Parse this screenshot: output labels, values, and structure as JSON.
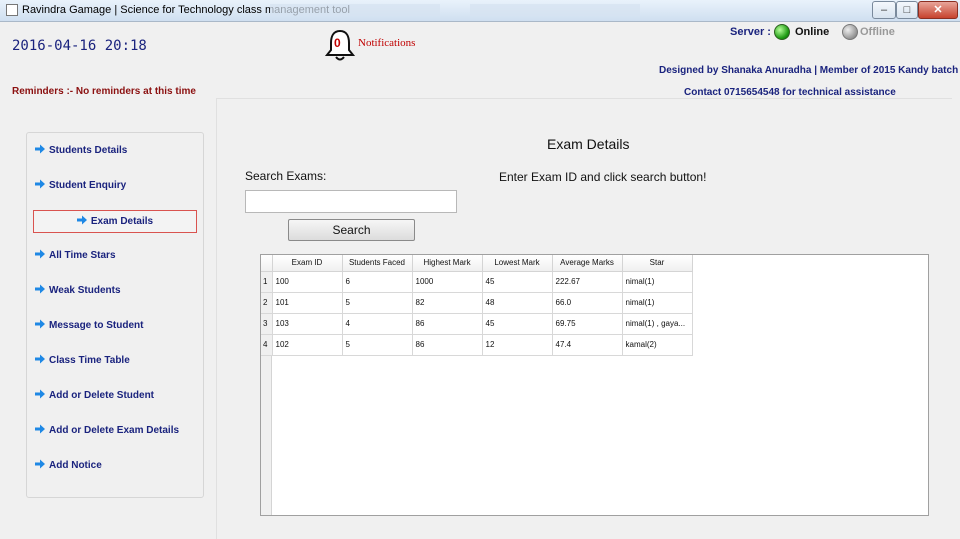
{
  "window": {
    "title": "Ravindra Gamage | Science for Technology class management tool",
    "minimize_label": "–",
    "maximize_label": "□",
    "close_label": "✕"
  },
  "header": {
    "datetime": "2016-04-16 20:18",
    "notification_count": "0",
    "notifications_label": "Notifications",
    "server_label": "Server :",
    "online_label": "Online",
    "offline_label": "Offline",
    "designer_text": "Designed by Shanaka Anuradha | Member of 2015 Kandy  batch",
    "contact_text": "Contact 0715654548 for technical assistance",
    "reminders_text": "Reminders :- No reminders at this time"
  },
  "sidebar": {
    "items": [
      {
        "label": "Students Details"
      },
      {
        "label": "Student Enquiry"
      },
      {
        "label": "Exam Details",
        "active": true
      },
      {
        "label": "All Time Stars"
      },
      {
        "label": "Weak Students"
      },
      {
        "label": "Message to Student"
      },
      {
        "label": "Class Time Table"
      },
      {
        "label": "Add or Delete Student"
      },
      {
        "label": "Add or Delete Exam Details"
      },
      {
        "label": "Add Notice"
      }
    ]
  },
  "main": {
    "title": "Exam Details",
    "search_label": "Search Exams:",
    "hint": "Enter Exam ID and click search button!",
    "search_value": "",
    "search_button": "Search",
    "table": {
      "columns": [
        "Exam ID",
        "Students Faced",
        "Highest Mark",
        "Lowest Mark",
        "Average Marks",
        "Star"
      ],
      "rows": [
        {
          "num": "1",
          "cells": [
            "100",
            "6",
            "1000",
            "45",
            "222.67",
            "nimal(1)"
          ]
        },
        {
          "num": "2",
          "cells": [
            "101",
            "5",
            "82",
            "48",
            "66.0",
            "nimal(1)"
          ]
        },
        {
          "num": "3",
          "cells": [
            "103",
            "4",
            "86",
            "45",
            "69.75",
            "nimal(1) , gaya..."
          ]
        },
        {
          "num": "4",
          "cells": [
            "102",
            "5",
            "86",
            "12",
            "47.4",
            "kamal(2)"
          ]
        }
      ]
    }
  },
  "colors": {
    "nav_text": "#1a237e",
    "accent_red": "#c00000",
    "online_green": "#1d9a12",
    "active_border": "#d9534f"
  }
}
